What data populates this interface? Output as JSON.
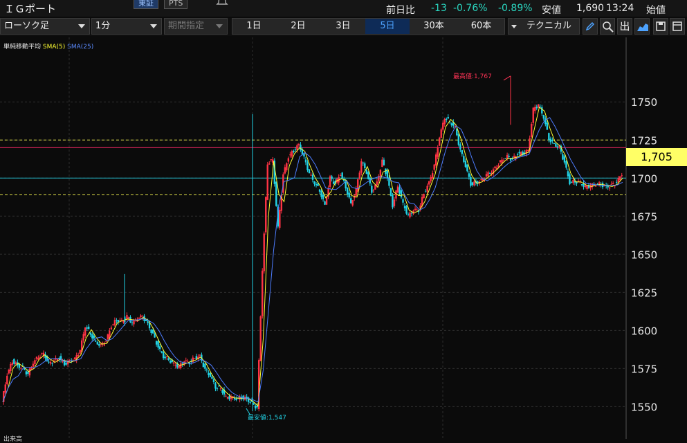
{
  "header": {
    "stock_name": "ＩＧポート",
    "market_tabs": [
      "東証",
      "PTS"
    ],
    "quote": {
      "prev_label": "前日比",
      "change": "-13",
      "change_pct": "-0.76%",
      "change_pct2": "-0.89%",
      "low_label": "安値",
      "low_value": "1,690",
      "time": "13:24",
      "open_label": "始値"
    }
  },
  "toolbar": {
    "chart_type": "ローソク足",
    "interval": "1分",
    "period_label": "期間指定",
    "ranges": [
      "1日",
      "2日",
      "3日",
      "5日",
      "30本",
      "60本"
    ],
    "active_range": "5日",
    "technical": "テクニカル",
    "icons": [
      "pen-icon",
      "magnifier-icon",
      "output-icon",
      "area-chart-icon",
      "save-icon",
      "panel-icon"
    ],
    "output_label": "出"
  },
  "indicator_legend": {
    "label": "単純移動平均",
    "sma5": "SMA(5)",
    "sma25": "SMA(25)"
  },
  "colors": {
    "up": "#ff3344",
    "down": "#22d3e6",
    "sma5": "#ffff33",
    "sma25": "#4d7dff",
    "current_line": "#22b8c8",
    "high_marker": "#ff3355",
    "low_marker": "#22d3e6"
  },
  "chart_data": {
    "type": "line",
    "ylim": [
      1542,
      1786
    ],
    "yticks": [
      1550,
      1575,
      1600,
      1625,
      1650,
      1675,
      1700,
      1725,
      1750
    ],
    "ytick_labels": [
      "1550",
      "1575",
      "1600",
      "1625",
      "1650",
      "1675",
      "1700",
      "1725",
      "1750"
    ],
    "current_price": 1705,
    "current_label": "1,705",
    "high_label": "最高値:1,767",
    "low_label": "最安値:1,547",
    "hlines": [
      {
        "value": 1725,
        "style": "dashed",
        "color": "#e5e54a"
      },
      {
        "value": 1720,
        "style": "solid",
        "color": "#ff2a6a"
      },
      {
        "value": 1700,
        "style": "solid",
        "color": "#22b8c8"
      },
      {
        "value": 1689,
        "style": "dashed",
        "color": "#e5e54a"
      }
    ],
    "price_path": [
      1553,
      1571,
      1580,
      1577,
      1575,
      1571,
      1579,
      1583,
      1585,
      1578,
      1580,
      1582,
      1578,
      1580,
      1581,
      1587,
      1603,
      1598,
      1592,
      1590,
      1593,
      1603,
      1607,
      1606,
      1609,
      1605,
      1608,
      1609,
      1604,
      1597,
      1589,
      1583,
      1581,
      1578,
      1576,
      1580,
      1579,
      1582,
      1583,
      1574,
      1570,
      1563,
      1562,
      1556,
      1556,
      1555,
      1556,
      1555,
      1552,
      1549,
      1640,
      1710,
      1712,
      1667,
      1702,
      1714,
      1718,
      1722,
      1713,
      1703,
      1697,
      1692,
      1682,
      1700,
      1696,
      1703,
      1694,
      1683,
      1692,
      1711,
      1704,
      1691,
      1697,
      1711,
      1700,
      1682,
      1695,
      1683,
      1675,
      1679,
      1679,
      1690,
      1697,
      1708,
      1727,
      1740,
      1737,
      1733,
      1718,
      1708,
      1696,
      1697,
      1698,
      1702,
      1704,
      1708,
      1712,
      1714,
      1712,
      1716,
      1716,
      1718,
      1745,
      1748,
      1740,
      1726,
      1722,
      1720,
      1710,
      1697,
      1698,
      1697,
      1694,
      1695,
      1696,
      1696,
      1694,
      1695,
      1697,
      1703
    ]
  },
  "bottom_label": "出来高"
}
